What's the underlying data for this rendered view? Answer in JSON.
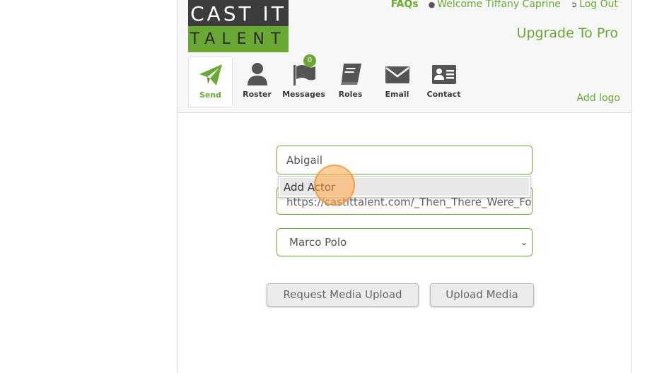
{
  "logo": {
    "line1": "CAST IT",
    "line2": "TALENT"
  },
  "top_links": {
    "faqs": "FAQs",
    "welcome": "Welcome Tiffany Caprine",
    "logout": "Log Out"
  },
  "upgrade": "Upgrade To Pro",
  "add_logo": "Add logo",
  "nav": {
    "send": "Send",
    "roster": "Roster",
    "messages": "Messages",
    "messages_badge": "0",
    "roles": "Roles",
    "email": "Email",
    "contact": "Contact"
  },
  "form": {
    "name_value": "Abigail",
    "autocomplete_item": "Add Actor",
    "url_value": "https://castittalent.com/_Then_There_Were_Fo",
    "select_value": "Marco Polo"
  },
  "buttons": {
    "request_upload": "Request Media Upload",
    "upload_media": "Upload Media"
  },
  "colors": {
    "accent": "#6aa834",
    "dark": "#3c3c3c"
  }
}
